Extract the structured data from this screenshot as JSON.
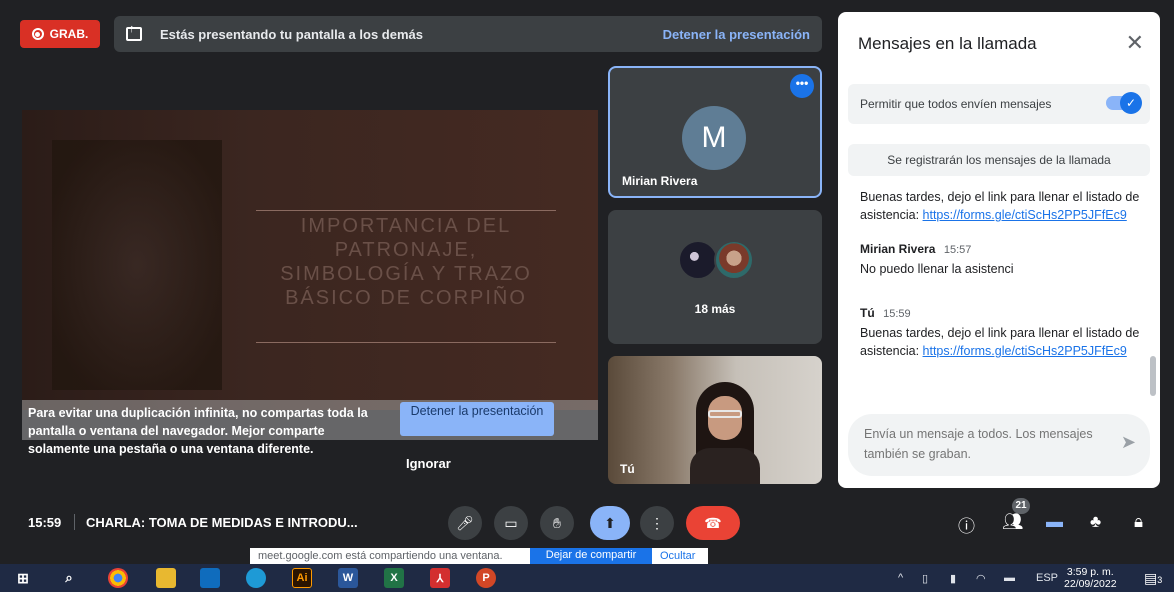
{
  "recording": {
    "label": "GRAB."
  },
  "banner": {
    "text": "Estás presentando tu pantalla a los demás",
    "stop_label": "Detener la presentación"
  },
  "slide": {
    "title_lines": [
      "IMPORTANCIA DEL",
      "PATRONAJE,",
      "SIMBOLOGÍA Y TRAZO",
      "BÁSICO DE CORPIÑO"
    ]
  },
  "warning": {
    "text": "Para evitar una duplicación infinita, no compartas toda la pantalla o ventana del navegador. Mejor comparte solamente una pestaña o una ventana diferente.",
    "stop_label": "Detener la presentación",
    "ignore_label": "Ignorar"
  },
  "tiles": {
    "mirian": {
      "initial": "M",
      "name": "Mirian Rivera",
      "more_glyph": "•••"
    },
    "others": {
      "count_label": "18 más"
    },
    "you": {
      "name": "Tú"
    }
  },
  "meeting": {
    "time": "15:59",
    "title": "CHARLA: TOMA DE MEDIDAS E INTRODU..."
  },
  "participants": {
    "count": "21"
  },
  "notification": {
    "text": "meet.google.com está compartiendo una ventana.",
    "button": "Dejar de compartir",
    "link": "Ocultar"
  },
  "chat": {
    "title": "Mensajes en la llamada",
    "permission_label": "Permitir que todos envíen mensajes",
    "note": "Se registrarán los mensajes de la llamada",
    "messages": [
      {
        "text": "Buenas tardes, dejo el link para llenar el listado de asistencia: ",
        "link": "https://forms.gle/ctiScHs2PP5JFfEc9"
      },
      {
        "author": "Mirian Rivera",
        "time": "15:57",
        "text": "No puedo llenar la asistenci"
      },
      {
        "author": "Tú",
        "time": "15:59",
        "text": "Buenas tardes, dejo el link para llenar el listado de asistencia: ",
        "link": "https://forms.gle/ctiScHs2PP5JFfEc9"
      }
    ],
    "compose_placeholder": "Envía un mensaje a todos. Los mensajes también se graban."
  },
  "taskbar": {
    "language": "ESP",
    "time": "3:59 p. m.",
    "date": "22/09/2022",
    "notification_count": "3",
    "apps": [
      "windows",
      "search",
      "chrome",
      "file-explorer",
      "outlook",
      "edge",
      "illustrator",
      "word",
      "excel",
      "acrobat",
      "powerpoint"
    ]
  },
  "colors": {
    "accent": "#8ab4f8",
    "record": "#d93025",
    "end_call": "#ea4335",
    "background": "#202124",
    "tile": "#3c4043"
  }
}
